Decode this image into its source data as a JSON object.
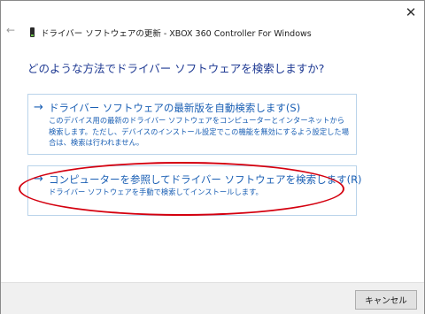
{
  "window": {
    "title": "ドライバー ソフトウェアの更新 - XBOX 360 Controller For Windows",
    "close_glyph": "✕",
    "back_glyph": "←"
  },
  "main": {
    "question": "どのような方法でドライバー ソフトウェアを検索しますか?",
    "options": [
      {
        "arrow": "→",
        "title": "ドライバー ソフトウェアの最新版を自動検索します(S)",
        "description": "このデバイス用の最新のドライバー ソフトウェアをコンピューターとインターネットから検索します。ただし、デバイスのインストール設定でこの機能を無効にするよう設定した場合は、検索は行われません。"
      },
      {
        "arrow": "→",
        "title": "コンピューターを参照してドライバー ソフトウェアを検索します(R)",
        "description": "ドライバー ソフトウェアを手動で検索してインストールします。"
      }
    ]
  },
  "footer": {
    "cancel_label": "キャンセル"
  },
  "colors": {
    "link": "#1a5fb4",
    "question": "#1f3a93",
    "highlight": "#d4000f",
    "option_border": "#b9d3ea"
  },
  "icons": {
    "device": "usb-device-icon",
    "back": "back-arrow-icon",
    "close": "close-icon"
  }
}
